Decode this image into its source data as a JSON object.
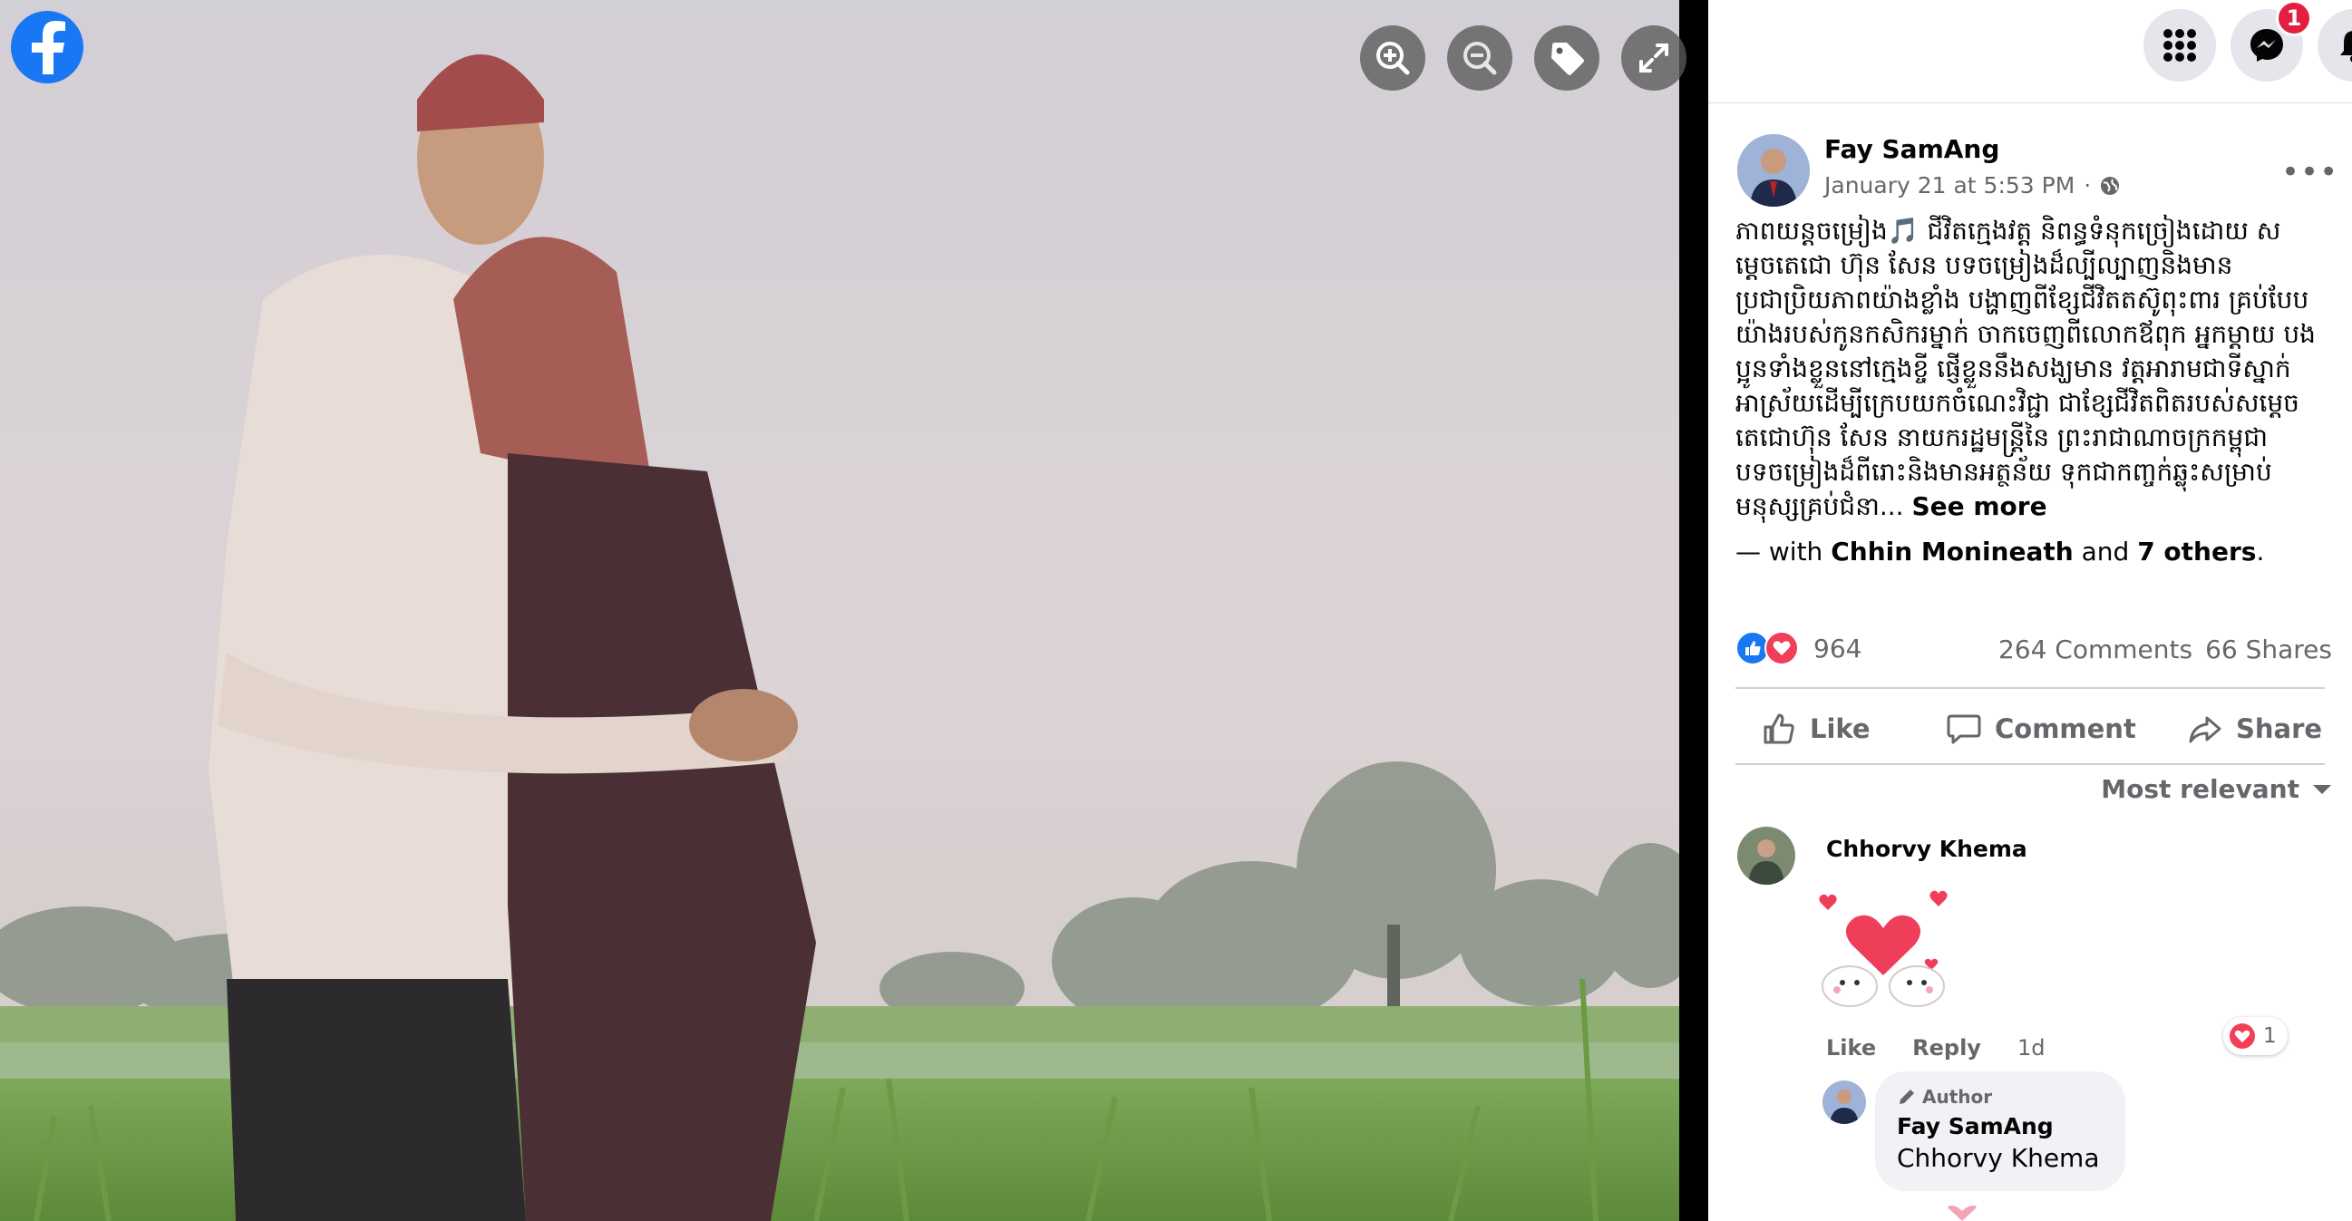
{
  "post": {
    "author": "Fay SamAng",
    "timestamp": "January 21 at 5:53 PM",
    "privacy_icon": "globe-icon",
    "text": "ភាពយន្តចម្រៀង🎵 ជីវិតក្មេងវត្ត និពន្ធទំនុកច្រៀងដោយ សម្តេចតេជោ ហ៊ុន សែន បទចម្រៀងដ៏ល្បីល្បាញនិងមាន ប្រជាប្រិយភាពយ៉ាងខ្លាំង បង្ហាញពីខ្សែជីវិតតស៊ូពុះពារ គ្រប់បែប យ៉ាងរបស់កូនកសិករម្នាក់ ចាកចេញពីលោកឪពុក អ្នកម្តាយ បងប្អូនទាំងខ្លួននៅក្មេងខ្ចី ផ្ញើខ្លួននឹងសង្ឃមាន វត្តអារាមជាទីស្នាក់អាស្រ័យដើម្បីក្រេបយកចំណេះវិជ្ជា ជាខ្សែជីវិតពិតរបស់សម្តេចតេជោហ៊ុន សែន នាយករដ្ឋមន្ត្រីនៃ ព្រះរាជាណាចក្រកម្ពុជា បទចម្រៀងដ៏ពីរោះនិងមានអត្ថន័យ ទុកជាកញ្ចក់ឆ្លុះសម្រាប់មនុស្សគ្រប់ជំនា...",
    "see_more": "See more",
    "with_prefix": "— with",
    "tagged_person": "Chhin Monineath",
    "and_text": "and",
    "others": "7 others",
    "period": "."
  },
  "stats": {
    "reactions_count": "964",
    "comments": "264 Comments",
    "shares": "66 Shares"
  },
  "actions": {
    "like": "Like",
    "comment": "Comment",
    "share": "Share"
  },
  "sort": {
    "label": "Most relevant"
  },
  "comment": {
    "name": "Chhorvy Khema",
    "like": "Like",
    "reply": "Reply",
    "time": "1d",
    "reaction_count": "1"
  },
  "reply": {
    "badge": "Author",
    "name": "Fay SamAng",
    "text": "Chhorvy Khema"
  },
  "notifications": {
    "messenger_badge": "1"
  },
  "colors": {
    "facebook_blue": "#1877f2",
    "badge_red": "#e41e3f",
    "secondary_text": "#65676b"
  }
}
